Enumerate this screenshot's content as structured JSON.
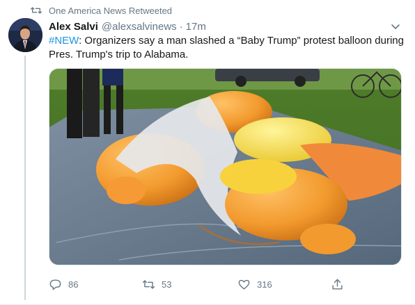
{
  "retweet_context": {
    "label": "One America News Retweeted",
    "icon": "retweet-icon"
  },
  "author": {
    "display_name": "Alex Salvi",
    "handle": "@alexsalvinews",
    "separator": "·",
    "time": "17m"
  },
  "tweet": {
    "hashtag": "#NEW",
    "text": ": Organizers say a man slashed a “Baby Trump” protest balloon during Pres. Trump's trip to Alabama."
  },
  "media": {
    "icon": "photo-media",
    "description_visible": false
  },
  "actions": {
    "reply": {
      "icon": "reply-icon",
      "count": "86"
    },
    "retweet": {
      "icon": "retweet-icon",
      "count": "53"
    },
    "like": {
      "icon": "heart-icon",
      "count": "316"
    },
    "share": {
      "icon": "share-icon"
    }
  },
  "colors": {
    "accent": "#1b95e0",
    "secondary_text": "#657786",
    "primary_text": "#14171a",
    "divider": "#ccd6dd"
  }
}
